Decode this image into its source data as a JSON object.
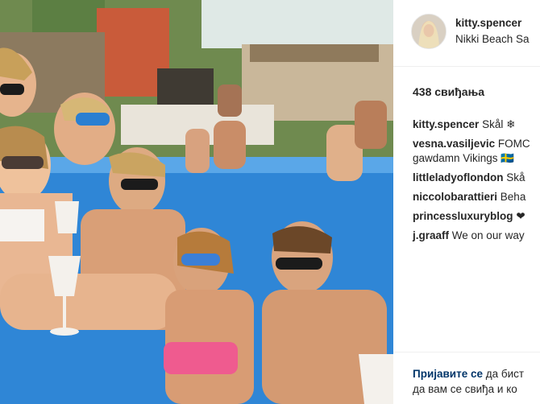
{
  "post": {
    "photo_alt": "",
    "username": "kitty.spencer",
    "location": "Nikki Beach Sa",
    "likes": "438 свиђања"
  },
  "comments": [
    {
      "user": "kitty.spencer",
      "text": "Skål ❄"
    },
    {
      "user": "vesna.vasiljevic",
      "text": "FOMC",
      "text2": "gawdamn Vikings 🇸🇪"
    },
    {
      "user": "littleladyoflondon",
      "text": "Skå"
    },
    {
      "user": "niccolobarattieri",
      "text": "Beha"
    },
    {
      "user": "princessluxuryblog",
      "text": "❤"
    },
    {
      "user": "j.graaff",
      "text": "We on our way"
    }
  ],
  "footer": {
    "login_link": "Пријавите се",
    "login_rest": "да бист",
    "line2": "да вам се свиђа и ко"
  },
  "colors": {
    "link": "#003569",
    "text": "#262626",
    "pool": "#2f86d6"
  }
}
